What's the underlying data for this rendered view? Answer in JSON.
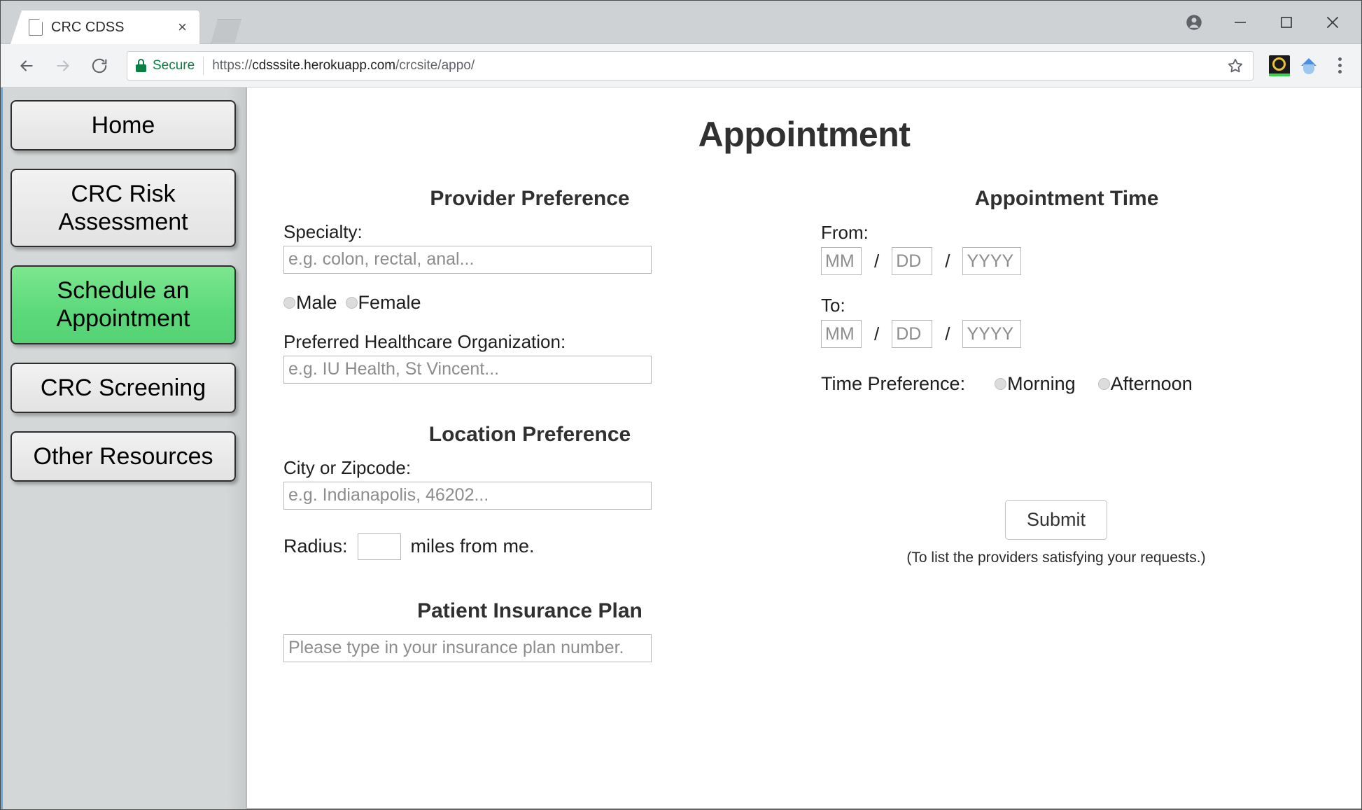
{
  "browser": {
    "tab": {
      "title": "CRC CDSS",
      "close_label": "×"
    },
    "url": {
      "secure_label": "Secure",
      "scheme": "https://",
      "host": "cdsssite.herokuapp.com",
      "path": "/crcsite/appo/"
    },
    "icons": {
      "page": "page-icon",
      "lock": "lock-icon",
      "back": "back-arrow-icon",
      "forward": "forward-arrow-icon",
      "reload": "reload-icon",
      "star": "star-icon",
      "extension_1": "extension-icon",
      "extension_2": "extension-icon",
      "menu": "three-dot-menu-icon",
      "profile": "profile-icon",
      "minimize": "minimize-icon",
      "maximize": "maximize-icon",
      "close": "window-close-icon"
    }
  },
  "sidebar": {
    "items": [
      {
        "label": "Home",
        "active": false
      },
      {
        "label": "CRC Risk Assessment",
        "active": false
      },
      {
        "label": "Schedule an Appointment",
        "active": true
      },
      {
        "label": "CRC Screening",
        "active": false
      },
      {
        "label": "Other Resources",
        "active": false
      }
    ],
    "active_color": "#5bd97a"
  },
  "main": {
    "title": "Appointment",
    "provider": {
      "heading": "Provider Preference",
      "specialty_label": "Specialty:",
      "specialty_placeholder": "e.g. colon, rectal, anal...",
      "specialty_value": "",
      "gender_male": "Male",
      "gender_female": "Female",
      "gender_selected": "",
      "org_label": "Preferred Healthcare Organization:",
      "org_placeholder": "e.g. IU Health, St Vincent...",
      "org_value": ""
    },
    "location": {
      "heading": "Location Preference",
      "city_label": "City or Zipcode:",
      "city_placeholder": "e.g. Indianapolis, 46202...",
      "city_value": "",
      "radius_label": "Radius:",
      "radius_value": "",
      "radius_suffix": "miles from me."
    },
    "insurance": {
      "heading": "Patient Insurance Plan",
      "placeholder": "Please type in your insurance plan number.",
      "value": ""
    },
    "appointment_time": {
      "heading": "Appointment Time",
      "from_label": "From:",
      "to_label": "To:",
      "mm_placeholder": "MM",
      "dd_placeholder": "DD",
      "yyyy_placeholder": "YYYY",
      "separator": "/",
      "from_mm": "",
      "from_dd": "",
      "from_yyyy": "",
      "to_mm": "",
      "to_dd": "",
      "to_yyyy": "",
      "time_pref_label": "Time Preference:",
      "morning": "Morning",
      "afternoon": "Afternoon",
      "time_pref_selected": ""
    },
    "submit": {
      "label": "Submit",
      "note": "(To list the providers satisfying your requests.)"
    }
  }
}
